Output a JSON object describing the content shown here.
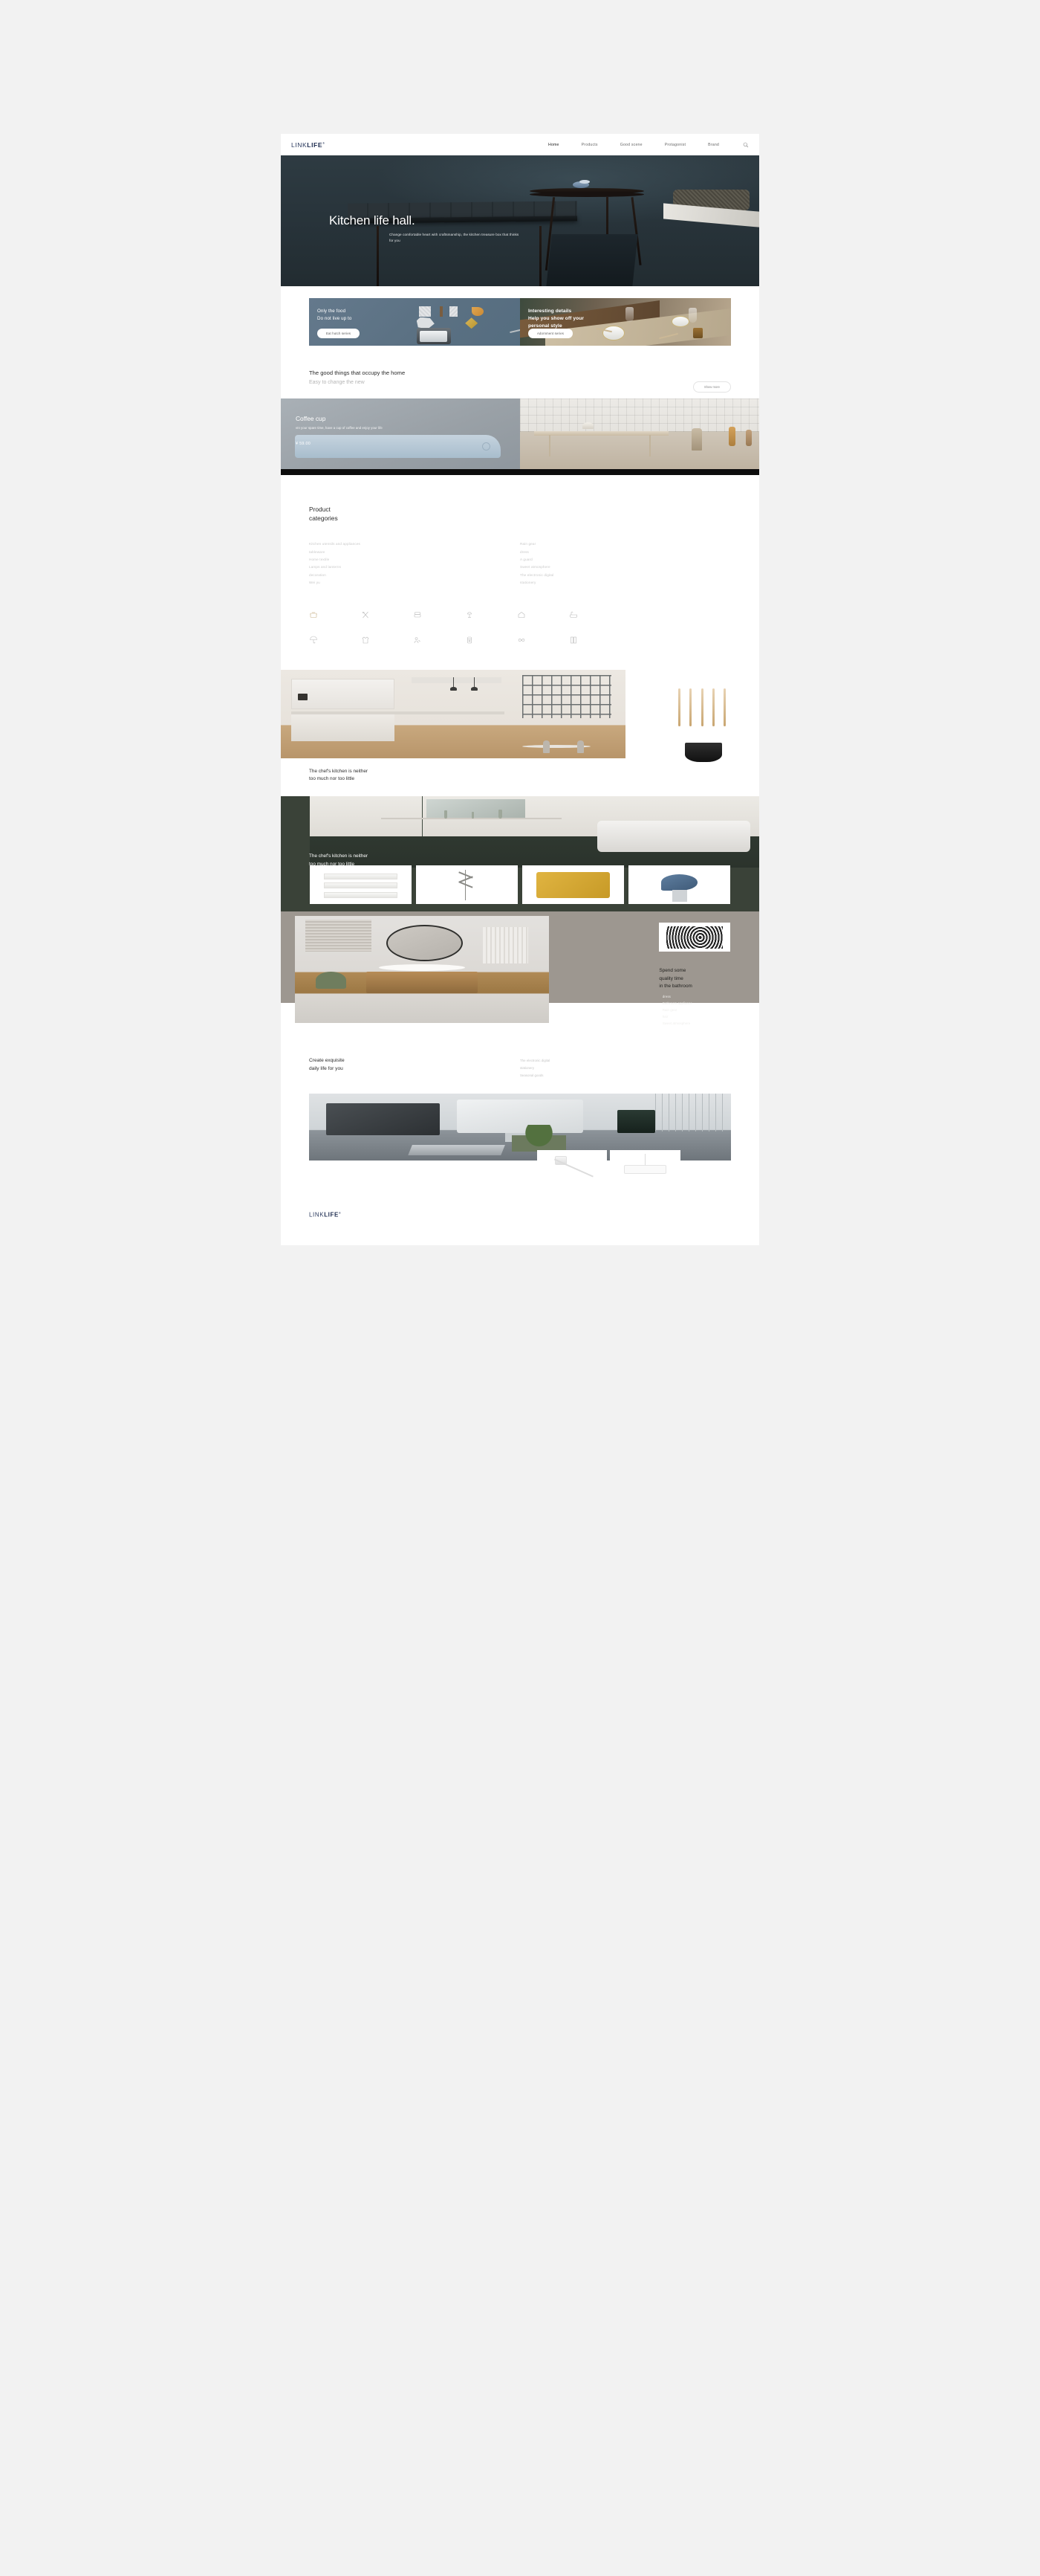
{
  "brand": {
    "part1": "LINK",
    "part2": "LIFE",
    "tm": "®"
  },
  "nav": {
    "items": [
      {
        "label": "Home",
        "active": true
      },
      {
        "label": "Products",
        "active": false
      },
      {
        "label": "Good scene",
        "active": false
      },
      {
        "label": "Protagonist",
        "active": false
      },
      {
        "label": "Brand",
        "active": false
      }
    ],
    "search_icon": "search-icon"
  },
  "hero": {
    "title": "Kitchen life hall.",
    "subtitle": "Change comfortable heart with craftsmanship, the kitchen treasure box that thinks for you"
  },
  "promos": [
    {
      "title": "Only the food\nDo not live up to",
      "button": "Eat hutch series",
      "bg": "#5a7082"
    },
    {
      "title": "Interesting details\nHelp you show off your\npersonal style",
      "button": "Adornment series",
      "bg": "#6e6150"
    }
  ],
  "good_things": {
    "heading": "The good things that occupy the home",
    "sub": "Easy to change the new",
    "button": "Show more"
  },
  "coffee": {
    "title": "Coffee cup",
    "desc": "vIn your spare time, have a cup of coffee and enjoy your life",
    "price": "¥ 59.00"
  },
  "categories": {
    "heading_line1": "Product",
    "heading_line2": "categories",
    "left": [
      "Kitchen utensils and appliances",
      "tableware",
      "Home textile",
      "Lamps and lanterns",
      "decoration",
      "Wei yu"
    ],
    "right": [
      "Rain gear",
      "dress",
      "A guard",
      "Sweet atmosphere",
      "The electronic digital",
      "stationery"
    ],
    "icons": [
      "pot-icon",
      "cutlery-icon",
      "sofa-icon",
      "lamp-icon",
      "house-icon",
      "bathtub-icon",
      "umbrella-icon",
      "shirt-icon",
      "guard-icon",
      "appliance-icon",
      "glasses-icon",
      "book-icon"
    ]
  },
  "showcase_kitchen": {
    "heading": "The chef's kitchen is neither\ntoo much nor too little"
  },
  "dark_section": {
    "heading": "The chef's kitchen is neither\ntoo much nor too little",
    "thumbs": [
      "drawer-thumb",
      "rack-thumb",
      "pillow-thumb",
      "lamp-thumb"
    ],
    "bg": "#3a4238"
  },
  "bathroom": {
    "heading": "Spend some\nquality time\nin the bathroom",
    "links": [
      "dress",
      "Bathroom appliance",
      "Rain gear",
      "hair",
      "Sweet atmosphere"
    ],
    "bg": "#9d9790"
  },
  "create": {
    "heading": "Create exquisite\ndaily life for you",
    "links": [
      "The electronic digital",
      "stationery",
      "Seasonal goods"
    ]
  },
  "desk": {
    "cards": [
      "usb-cable-card",
      "power-hub-card"
    ]
  }
}
